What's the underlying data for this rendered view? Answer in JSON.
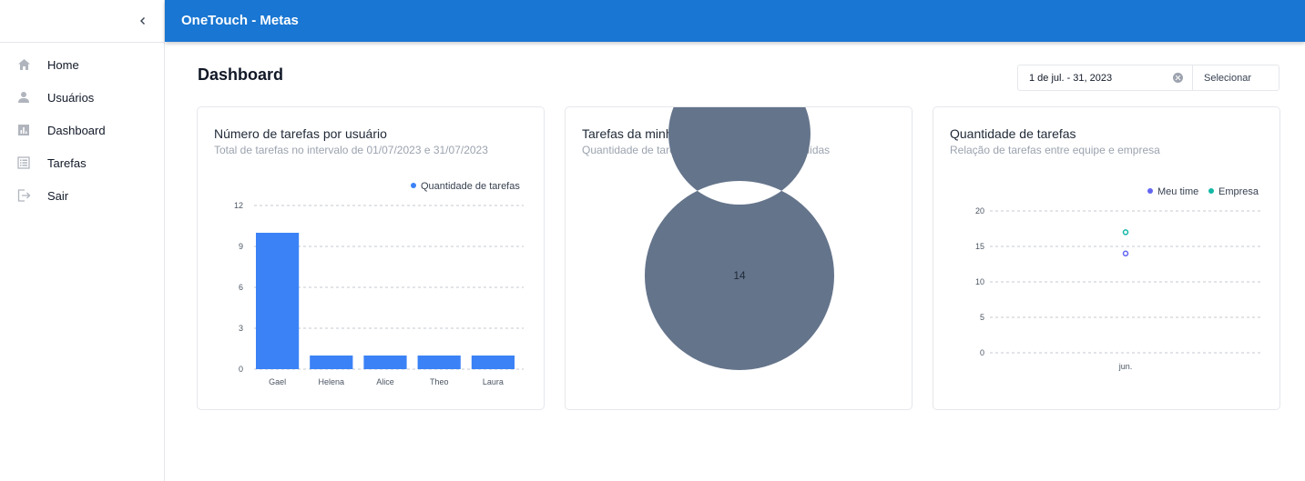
{
  "app": {
    "title": "OneTouch - Metas"
  },
  "sidebar": {
    "items": [
      {
        "label": "Home",
        "icon": "home-icon"
      },
      {
        "label": "Usuários",
        "icon": "user-icon"
      },
      {
        "label": "Dashboard",
        "icon": "bar-chart-icon"
      },
      {
        "label": "Tarefas",
        "icon": "list-icon"
      },
      {
        "label": "Sair",
        "icon": "logout-icon"
      }
    ]
  },
  "page": {
    "title": "Dashboard"
  },
  "date_filter": {
    "value": "1 de jul. - 31, 2023",
    "select_label": "Selecionar"
  },
  "colors": {
    "primary": "#1976d2",
    "bar": "#3b82f6",
    "donut": "#64748b",
    "meu_time": "#6366f1",
    "empresa": "#14b8a6"
  },
  "cards": [
    {
      "title": "Número de tarefas por usuário",
      "subtitle": "Total de tarefas no intervalo de 01/07/2023 e 31/07/2023"
    },
    {
      "title": "Tarefas da minha equipe",
      "subtitle": "Quantidade de tarefas concluidas e não concluidas"
    },
    {
      "title": "Quantidade de tarefas",
      "subtitle": "Relação de tarefas entre equipe e empresa"
    }
  ],
  "chart_data": [
    {
      "type": "bar",
      "categories": [
        "Gael",
        "Helena",
        "Alice",
        "Theo",
        "Laura"
      ],
      "series": [
        {
          "name": "Quantidade de tarefas",
          "values": [
            10,
            1,
            1,
            1,
            1
          ]
        }
      ],
      "ylim": [
        0,
        12
      ],
      "yticks": [
        "0",
        "3",
        "6",
        "9",
        "12"
      ],
      "grid": true,
      "legend": "top-right"
    },
    {
      "type": "pie",
      "center_label": "14",
      "slices": [
        {
          "value": 14
        }
      ]
    },
    {
      "type": "scatter",
      "categories": [
        "jun."
      ],
      "series": [
        {
          "name": "Meu time",
          "values": [
            14
          ]
        },
        {
          "name": "Empresa",
          "values": [
            17
          ]
        }
      ],
      "ylim": [
        0,
        20
      ],
      "yticks": [
        "0",
        "5",
        "10",
        "15",
        "20"
      ],
      "grid": true,
      "legend": "top-right"
    }
  ]
}
